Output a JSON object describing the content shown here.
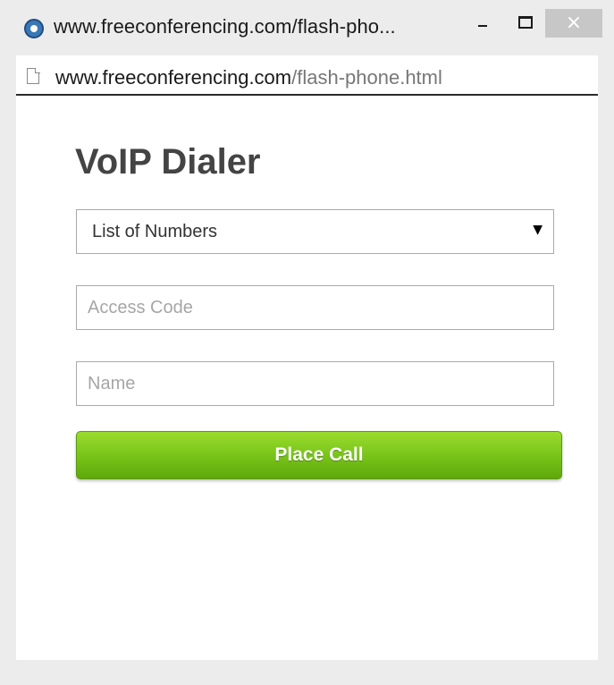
{
  "window": {
    "title": "www.freeconferencing.com/flash-pho...",
    "controls": {
      "minimize_icon": "minimize-icon",
      "maximize_icon": "maximize-icon",
      "close_icon": "close-icon",
      "close_glyph": "×"
    }
  },
  "address": {
    "domain": "www.freeconferencing.com",
    "path": "/flash-phone.html",
    "page_icon": "page-icon"
  },
  "dialer": {
    "heading": "VoIP Dialer",
    "numbers_select": {
      "selected": "List of Numbers",
      "arrow": "▼"
    },
    "access_code_placeholder": "Access Code",
    "name_placeholder": "Name",
    "place_call_label": "Place Call"
  },
  "colors": {
    "button_green": "#79c51a",
    "heading_gray": "#444444",
    "close_button_bg": "#c7c7c7"
  }
}
